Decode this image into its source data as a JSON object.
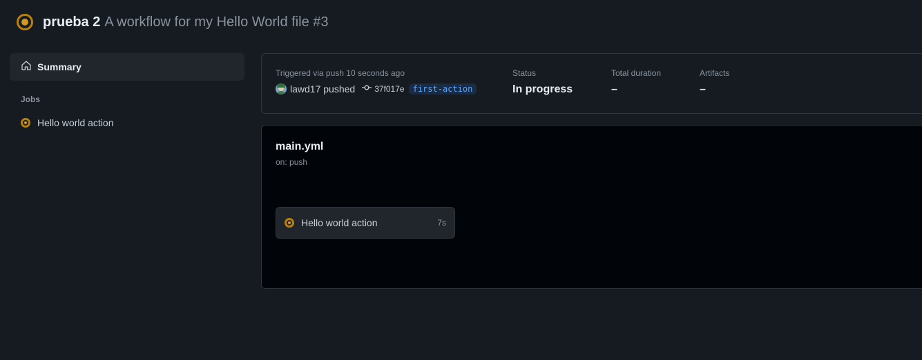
{
  "header": {
    "workflow_name": "prueba 2",
    "run_title": "A workflow for my Hello World file #3"
  },
  "sidebar": {
    "summary_label": "Summary",
    "jobs_heading": "Jobs",
    "jobs": [
      {
        "label": "Hello world action"
      }
    ]
  },
  "run_info": {
    "trigger_text": "Triggered via push 10 seconds ago",
    "actor": "lawd17",
    "action": "pushed",
    "commit_sha": "37f017e",
    "branch": "first-action",
    "status_label": "Status",
    "status_value": "In progress",
    "duration_label": "Total duration",
    "duration_value": "–",
    "artifacts_label": "Artifacts",
    "artifacts_value": "–"
  },
  "graph": {
    "workflow_file": "main.yml",
    "trigger": "on: push",
    "jobs": [
      {
        "label": "Hello world action",
        "duration": "7s"
      }
    ]
  },
  "colors": {
    "in_progress": "#d29922",
    "background": "#161b22",
    "graph_background": "#010409",
    "accent": "#58a6ff"
  }
}
